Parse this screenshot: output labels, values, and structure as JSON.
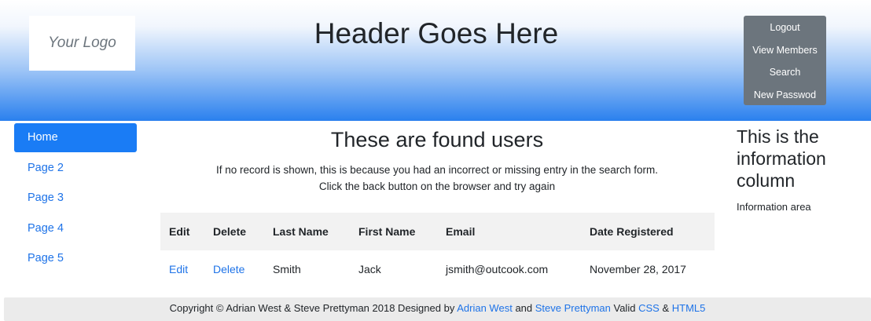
{
  "header": {
    "logo_text": "Your Logo",
    "title": "Header Goes Here",
    "menu": [
      "Logout",
      "View Members",
      "Search",
      "New Passwod"
    ]
  },
  "sidebar": {
    "items": [
      {
        "label": "Home",
        "active": true
      },
      {
        "label": "Page 2",
        "active": false
      },
      {
        "label": "Page 3",
        "active": false
      },
      {
        "label": "Page 4",
        "active": false
      },
      {
        "label": "Page 5",
        "active": false
      }
    ]
  },
  "main": {
    "title": "These are found users",
    "note_line1": "If no record is shown, this is because you had an incorrect or missing entry in the search form.",
    "note_line2": "Click the back button on the browser and try again",
    "table": {
      "headers": [
        "Edit",
        "Delete",
        "Last Name",
        "First Name",
        "Email",
        "Date Registered"
      ],
      "rows": [
        [
          "Edit",
          "Delete",
          "Smith",
          "Jack",
          "jsmith@outcook.com",
          "November 28, 2017"
        ]
      ]
    }
  },
  "info": {
    "title": "This is the information column",
    "text": "Information area"
  },
  "footer": {
    "copyright": "Copyright © Adrian West & Steve Prettyman 2018 Designed by",
    "designer1": "Adrian West",
    "and_text": "and",
    "designer2": "Steve Prettyman",
    "valid_text": "Valid",
    "css_link": "CSS",
    "amp_text": "&",
    "html_link": "HTML5"
  },
  "colors": {
    "accent": "#1a7cf5",
    "link": "#1e73e8",
    "menu_bg": "#6c757d",
    "footer_bg": "#ebebeb"
  }
}
